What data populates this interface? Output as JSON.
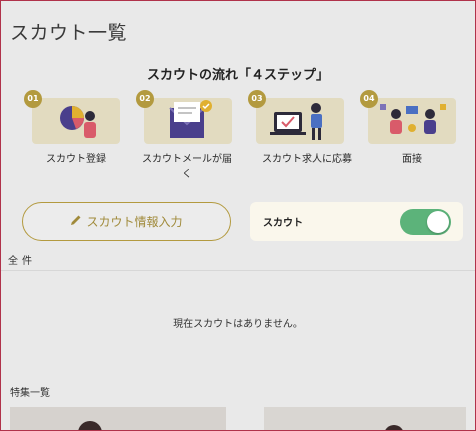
{
  "page": {
    "title": "スカウト一覧"
  },
  "flow": {
    "title": "スカウトの流れ「４ステップ」",
    "steps": [
      {
        "num": "01",
        "label": "スカウト登録"
      },
      {
        "num": "02",
        "label": "スカウトメールが届く"
      },
      {
        "num": "03",
        "label": "スカウト求人に応募"
      },
      {
        "num": "04",
        "label": "面接"
      }
    ]
  },
  "actions": {
    "input_button_label": "スカウト情報入力",
    "toggle_label": "スカウト",
    "toggle_on": true
  },
  "list": {
    "count_label": "全件",
    "empty_message": "現在スカウトはありません。"
  },
  "features": {
    "title": "特集一覧"
  },
  "colors": {
    "accent": "#b39a3f",
    "toggle": "#5cb37a",
    "background": "#e9e9e9"
  }
}
